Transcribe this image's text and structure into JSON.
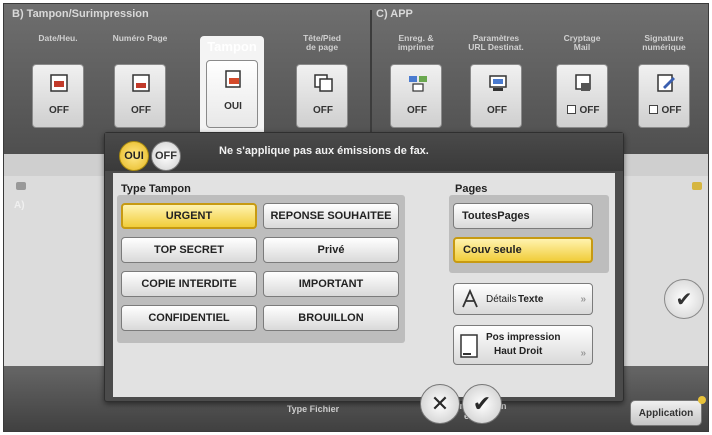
{
  "top": {
    "group_b_label": "B)  Tampon/Surimpression",
    "group_c_label": "C)  APP",
    "functions": [
      {
        "title": "Date/Heu.",
        "value": "OFF"
      },
      {
        "title": "Numéro Page",
        "value": "OFF"
      },
      {
        "title": "Tampon",
        "value": "OUI"
      },
      {
        "title": "Tête/Pied\nde page",
        "value": "OFF"
      },
      {
        "title": "Enreg. &\nimprimer",
        "value": "OFF"
      },
      {
        "title": "Paramètres\nURL Destinat.",
        "value": "OFF"
      },
      {
        "title": "Cryptage\nMail",
        "value": "OFF"
      },
      {
        "title": "Signature\nnumérique",
        "value": "OFF"
      }
    ]
  },
  "background": {
    "section_a": "A)",
    "bottom_type_fichier": "Type Fichier",
    "bottom_config_email": "Configuration\ne-mail",
    "application_button": "Application"
  },
  "dialog": {
    "toggle_on": "OUI",
    "toggle_off": "OFF",
    "message": "Ne s'applique pas aux émissions de fax.",
    "type_title": "Type Tampon",
    "stamps": [
      "URGENT",
      "REPONSE SOUHAITEE",
      "TOP SECRET",
      "Privé",
      "COPIE INTERDITE",
      "IMPORTANT",
      "CONFIDENTIEL",
      "BROUILLON"
    ],
    "pages_title": "Pages",
    "pages_options": [
      "ToutesPages",
      "Couv seule"
    ],
    "details_text_a": "Détails ",
    "details_text_b": "Texte",
    "pos_label": "Pos impression",
    "pos_value": "Haut Droit"
  },
  "colors": {
    "selected_fill": "#f1cd3a",
    "selected_border": "#c79a12"
  },
  "icons": {
    "close": "x-icon",
    "confirm": "check-icon",
    "arrow": "double-chevron-right-icon"
  }
}
